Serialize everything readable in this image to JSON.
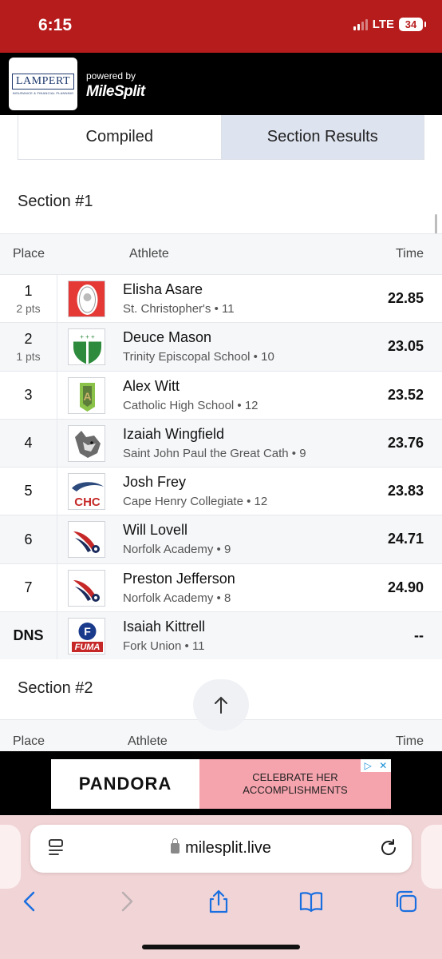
{
  "status_bar": {
    "time": "6:15",
    "network": "LTE",
    "battery": "34"
  },
  "header": {
    "sponsor_name": "LAMPERT",
    "sponsor_tagline": "INSURANCE & FINANCIAL PLANNING",
    "powered_by": "powered by",
    "brand": "MileSplit"
  },
  "tabs": [
    {
      "label": "Compiled",
      "active": false
    },
    {
      "label": "Section Results",
      "active": true
    }
  ],
  "section1": {
    "title": "Section #1",
    "columns": {
      "place": "Place",
      "athlete": "Athlete",
      "time": "Time"
    },
    "rows": [
      {
        "place": "1",
        "points": "2 pts",
        "name": "Elisha Asare",
        "meta": "St. Christopher's • 11",
        "time": "22.85",
        "logo": "st-christophers-logo"
      },
      {
        "place": "2",
        "points": "1 pts",
        "name": "Deuce Mason",
        "meta": "Trinity Episcopal School • 10",
        "time": "23.05",
        "logo": "trinity-episcopal-logo"
      },
      {
        "place": "3",
        "points": "",
        "name": "Alex Witt",
        "meta": "Catholic High School • 12",
        "time": "23.52",
        "logo": "catholic-high-logo"
      },
      {
        "place": "4",
        "points": "",
        "name": "Izaiah Wingfield",
        "meta": "Saint John Paul the Great Cath • 9",
        "time": "23.76",
        "logo": "saint-john-paul-logo"
      },
      {
        "place": "5",
        "points": "",
        "name": "Josh Frey",
        "meta": "Cape Henry Collegiate • 12",
        "time": "23.83",
        "logo": "cape-henry-logo"
      },
      {
        "place": "6",
        "points": "",
        "name": "Will Lovell",
        "meta": "Norfolk Academy • 9",
        "time": "24.71",
        "logo": "norfolk-academy-logo"
      },
      {
        "place": "7",
        "points": "",
        "name": "Preston Jefferson",
        "meta": "Norfolk Academy • 8",
        "time": "24.90",
        "logo": "norfolk-academy-logo"
      },
      {
        "place": "DNS",
        "points": "",
        "name": "Isaiah Kittrell",
        "meta": "Fork Union • 11",
        "time": "--",
        "logo": "fork-union-logo"
      }
    ]
  },
  "section2": {
    "title": "Section #2",
    "columns": {
      "place": "Place",
      "athlete": "Athlete",
      "time": "Time"
    }
  },
  "ad": {
    "brand": "PANDORA",
    "line1": "CELEBRATE HER",
    "line2": "ACCOMPLISHMENTS"
  },
  "browser": {
    "url": "milesplit.live"
  },
  "colors": {
    "status_bar": "#b71c1c",
    "tab_active": "#dde3ef",
    "ad_pink": "#f5a3ad",
    "chrome": "#f1d4d6",
    "ios_blue": "#1a6fe0"
  }
}
